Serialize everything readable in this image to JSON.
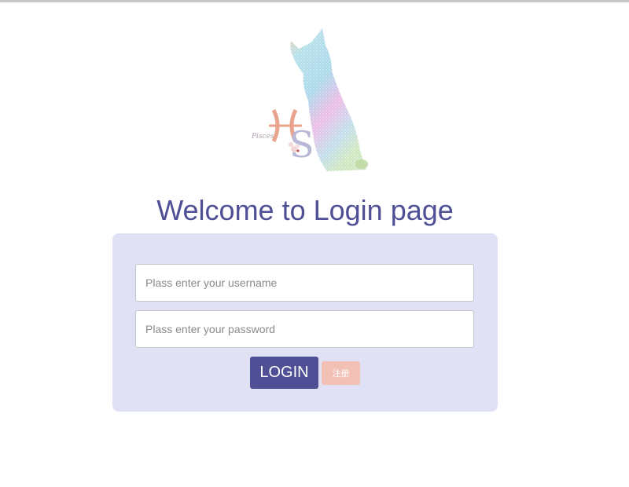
{
  "logo": {
    "icon": "cat-logo-icon",
    "text": "Pisces",
    "accent_colors": [
      "#e9a38f",
      "#9fd6e6",
      "#e8a8dc",
      "#b7b7d8",
      "#d4b88a"
    ]
  },
  "page": {
    "title": "Welcome to Login page"
  },
  "form": {
    "username_placeholder": "Plass enter your username",
    "password_placeholder": "Plass enter your password",
    "login_label": "LOGIN",
    "register_label": "注册"
  },
  "colors": {
    "brand": "#4f4f96",
    "panel_bg": "#e1e1f5",
    "register_bg": "#f3c0b6"
  }
}
